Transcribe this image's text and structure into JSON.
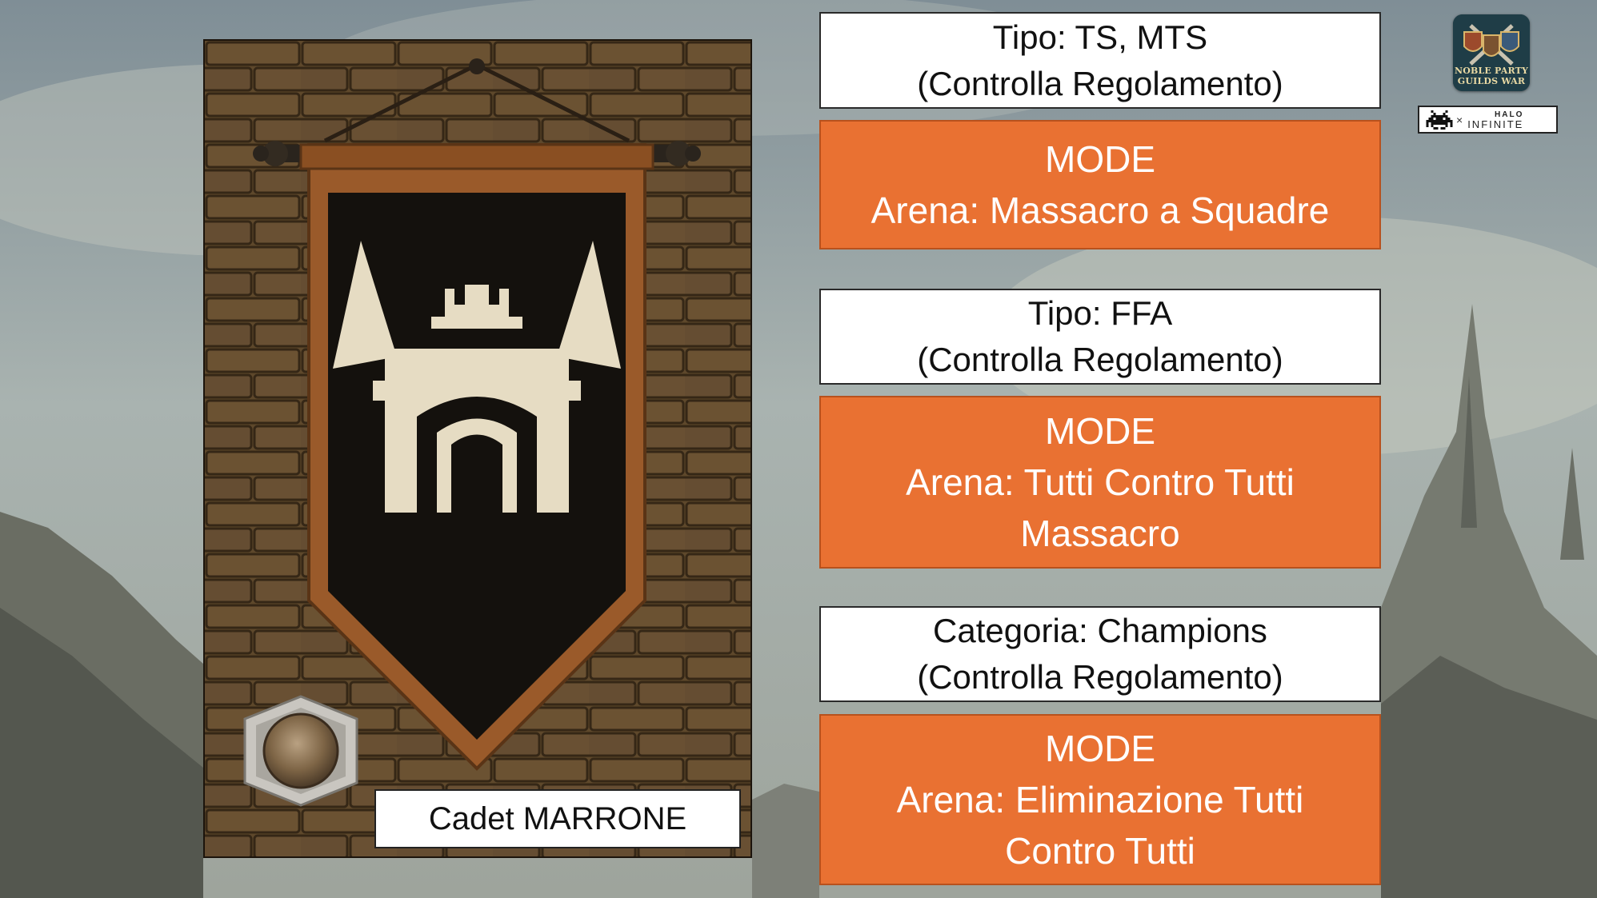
{
  "rank": {
    "label": "Cadet MARRONE"
  },
  "modes": [
    {
      "type_lines": [
        "Tipo: TS, MTS",
        "(Controlla Regolamento)"
      ],
      "mode_lines": [
        "MODE",
        "Arena: Massacro a Squadre"
      ]
    },
    {
      "type_lines": [
        "Tipo: FFA",
        "(Controlla Regolamento)"
      ],
      "mode_lines": [
        "MODE",
        "Arena: Tutti Contro Tutti",
        "Massacro"
      ]
    },
    {
      "type_lines": [
        "Categoria: Champions",
        "(Controlla Regolamento)"
      ],
      "mode_lines": [
        "MODE",
        "Arena: Eliminazione Tutti",
        "Contro Tutti"
      ]
    }
  ],
  "logos": {
    "noble_party_line1": "NOBLE PARTY",
    "noble_party_line2": "GUILDS WAR",
    "collab_x": "×",
    "halo_top": "HALO",
    "halo_bottom": "INFINITE"
  },
  "colors": {
    "accent_orange": "#e97132",
    "banner_black": "#14110d",
    "banner_trim": "#9a5a2a",
    "emblem_cream": "#e6dcc3"
  },
  "icons": [
    "banner-emblem-icon",
    "rank-medal-icon",
    "noble-party-logo-icon",
    "space-invader-icon"
  ]
}
